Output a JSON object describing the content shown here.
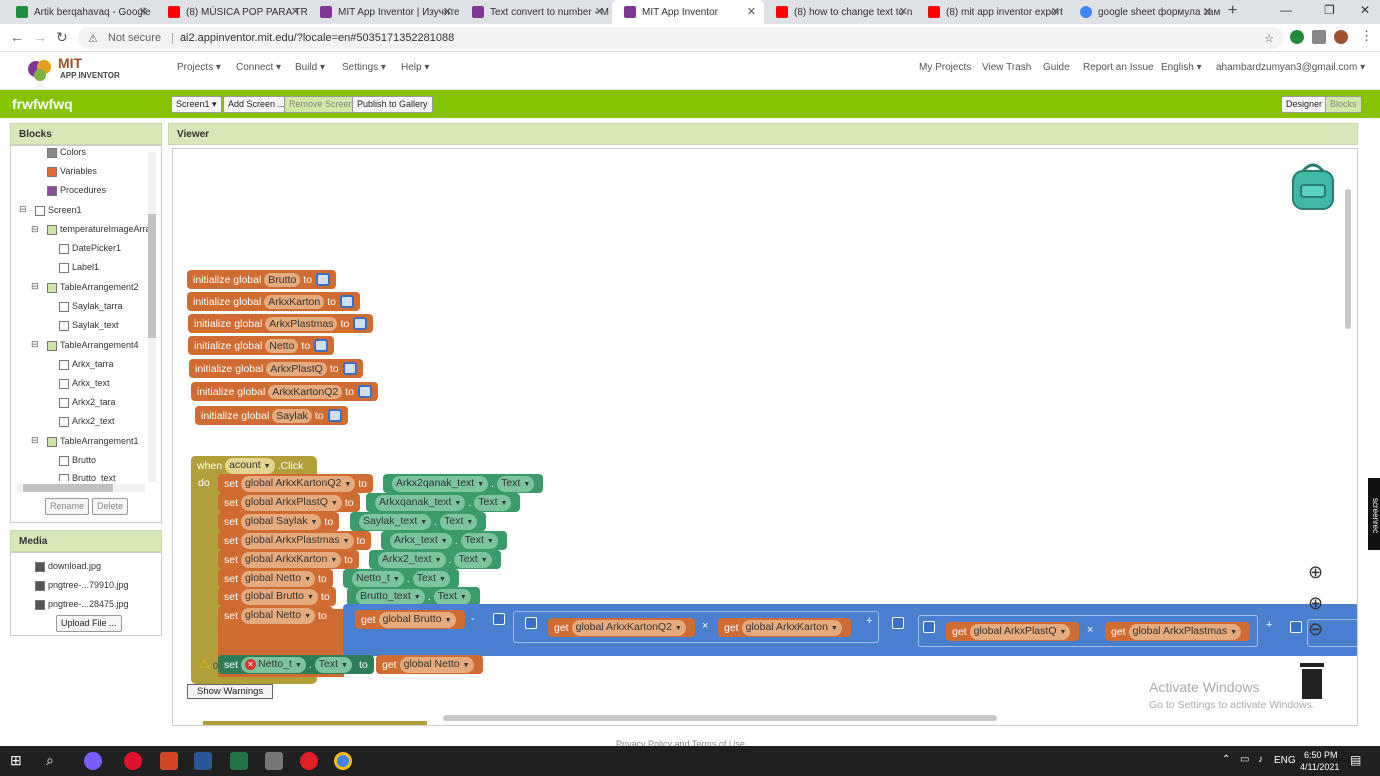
{
  "tabs": [
    {
      "label": "Artik berqahavaq - Google",
      "color": "#1e8e3e"
    },
    {
      "label": "(8) MÚSICA POP PARA TRA",
      "color": "#ff0000"
    },
    {
      "label": "MIT App Inventor | Изучите",
      "color": "#7e3794"
    },
    {
      "label": "Text convert to number - M",
      "color": "#7e3794"
    },
    {
      "label": "MIT App Inventor",
      "color": "#7e3794"
    },
    {
      "label": "(8) how to change text to n",
      "color": "#ff0000"
    },
    {
      "label": "(8) mit app inventor export",
      "color": "#ff0000"
    },
    {
      "label": "google sheet формула зам",
      "color": "#4285f4"
    }
  ],
  "address": {
    "security": "Not secure",
    "url": "ai2.appinventor.mit.edu/?locale=en#5035171352281088"
  },
  "app": {
    "logo_line1": "MIT",
    "logo_line2": "APP INVENTOR",
    "menus": [
      "Projects ▾",
      "Connect ▾",
      "Build ▾",
      "Settings ▾",
      "Help ▾"
    ],
    "right_links": [
      "My Projects",
      "View Trash",
      "Guide",
      "Report an Issue",
      "English ▾",
      "ahambardzumyan3@gmail.com ▾"
    ]
  },
  "project": {
    "name": "frwfwfwq",
    "buttons": [
      "Screen1 ▾",
      "Add Screen ...",
      "Remove Screen",
      "Publish to Gallery"
    ],
    "mode_buttons": [
      "Designer",
      "Blocks"
    ]
  },
  "blocks_panel": {
    "title": "Blocks",
    "items": [
      "Colors",
      "Variables",
      "Procedures",
      "Screen1",
      "temperatureImageArra",
      "DatePicker1",
      "Label1",
      "TableArrangement2",
      "Saylak_tarra",
      "Saylak_text",
      "TableArrangement4",
      "Arkx_tarra",
      "Arkx_text",
      "Arkx2_tara",
      "Arkx2_text",
      "TableArrangement1",
      "Brutto",
      "Brutto_text"
    ],
    "rename": "Rename",
    "delete": "Delete"
  },
  "media_panel": {
    "title": "Media",
    "files": [
      "download.jpg",
      "pngtree-...79910.jpg",
      "pngtree-...28475.jpg"
    ],
    "upload": "Upload File ..."
  },
  "viewer": {
    "title": "Viewer",
    "init_prefix": "initialize global",
    "init_to": "to",
    "globals": [
      "Brutto",
      "ArkxKarton",
      "ArkxPlastmas",
      "Netto",
      "ArkxPlastQ",
      "ArkxKartonQ2",
      "Saylak"
    ],
    "event": {
      "when": "when",
      "component": "acount",
      "event": ".Click",
      "do": "do"
    },
    "set_label": "set",
    "to_label": "to",
    "get_label": "get",
    "text_prop": "Text",
    "sets": [
      {
        "var": "global ArkxKartonQ2",
        "comp": "Arkx2qanak_text"
      },
      {
        "var": "global ArkxPlastQ",
        "comp": "Arkxqanak_text"
      },
      {
        "var": "global Saylak",
        "comp": "Saylak_text"
      },
      {
        "var": "global ArkxPlastmas",
        "comp": "Arkx_text"
      },
      {
        "var": "global ArkxKarton",
        "comp": "Arkx2_text"
      },
      {
        "var": "global Netto",
        "comp": "Netto_t"
      },
      {
        "var": "global Brutto",
        "comp": "Brutto_text"
      }
    ],
    "netto_expr": {
      "var": "global Netto",
      "g1": "global Brutto",
      "g2": "global ArkxKartonQ2",
      "g3": "global ArkxKarton",
      "g4": "global ArkxPlastQ",
      "g5": "global ArkxPlastmas",
      "minus": "-",
      "times": "×",
      "plus": "+"
    },
    "last_set": {
      "comp": "Netto_t",
      "get": "global Netto"
    },
    "show_warnings": "Show Warnings",
    "warn_count": "0",
    "activate_title": "Activate Windows",
    "activate_sub": "Go to Settings to activate Windows."
  },
  "footer": "Privacy Policy and Terms of Use",
  "taskbar": {
    "lang": "ENG",
    "time": "6:50 PM",
    "date": "4/11/2021"
  },
  "screenrec": "screenrec"
}
